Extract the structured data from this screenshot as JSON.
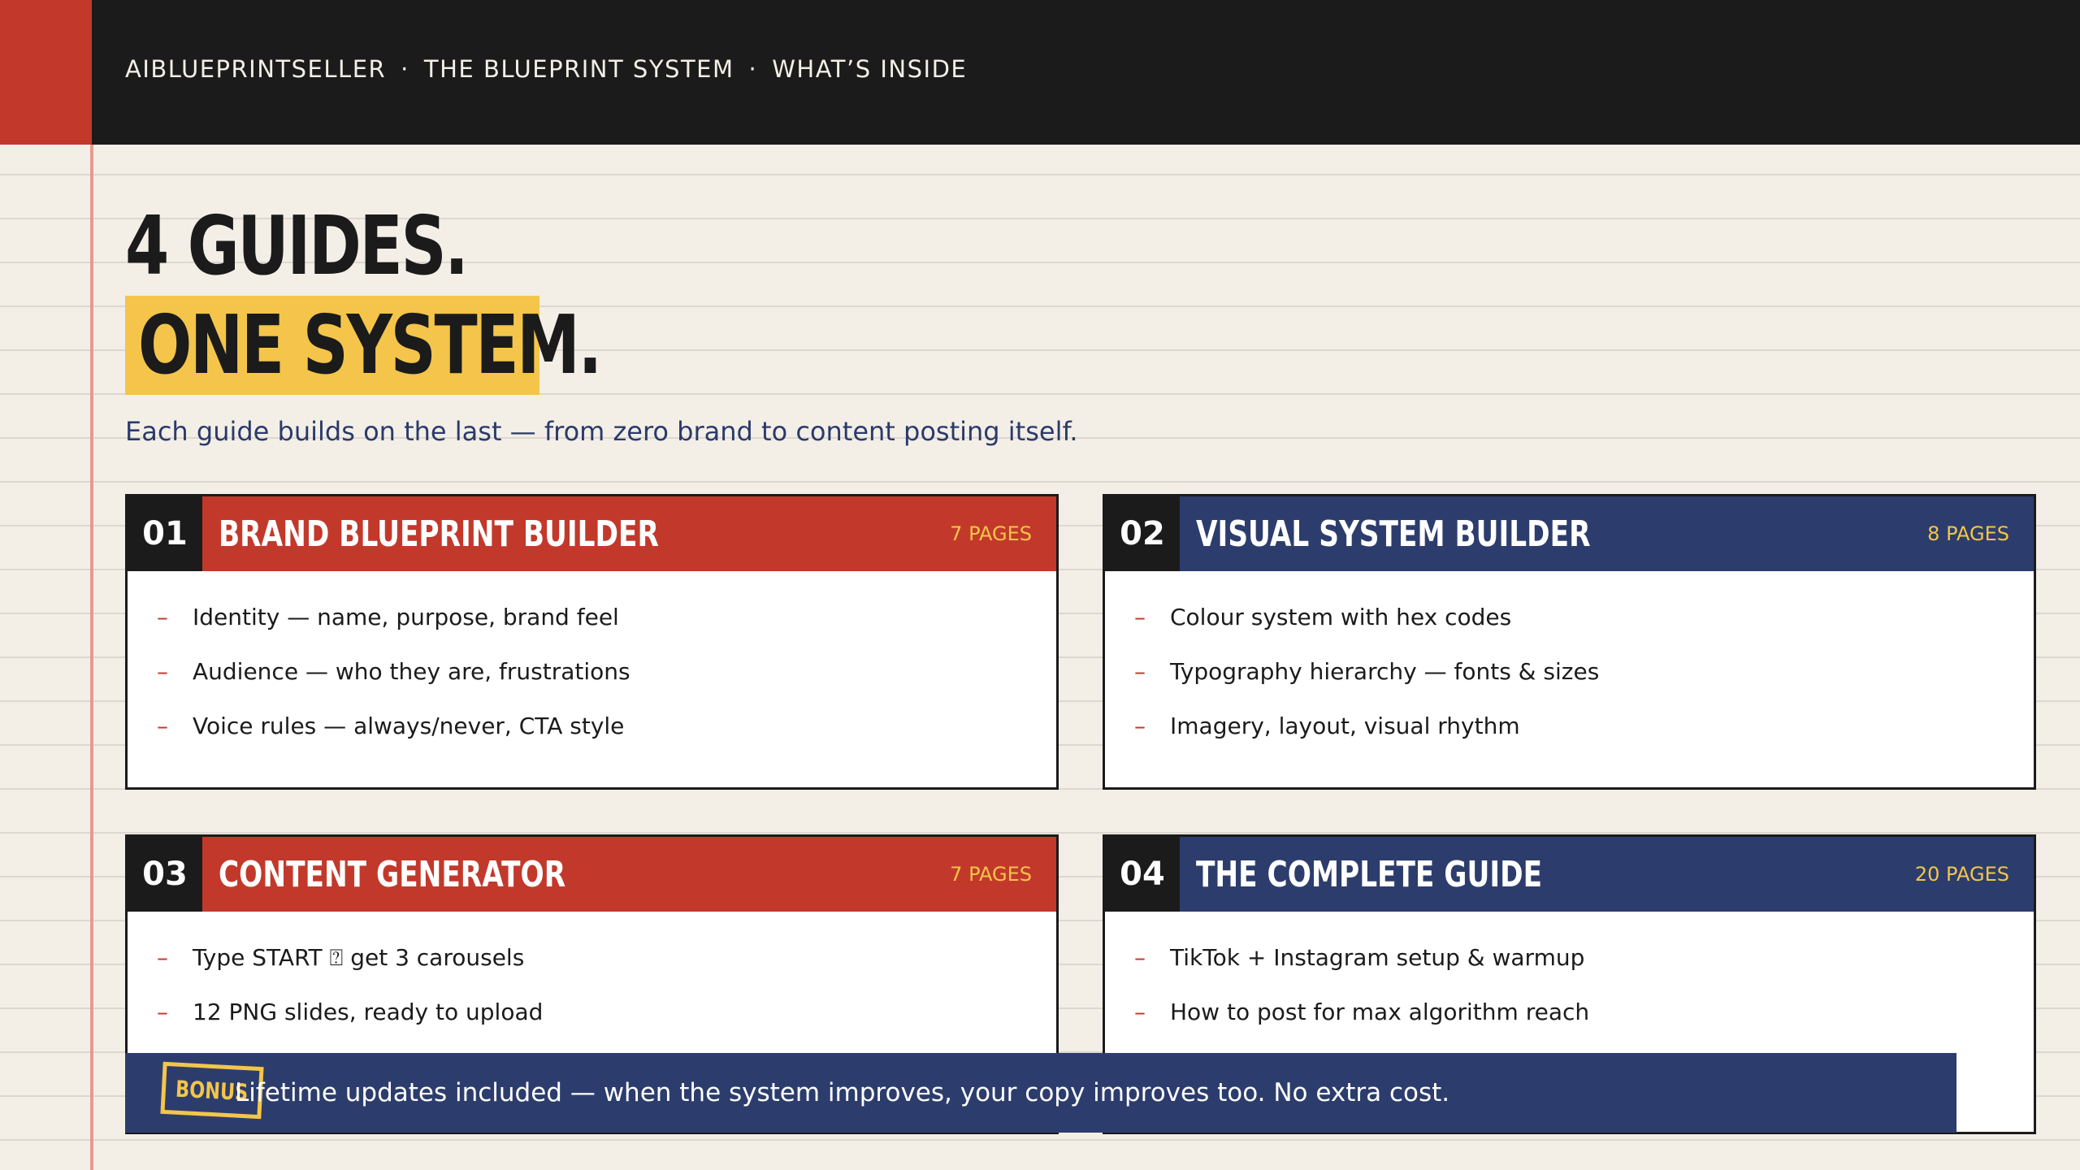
{
  "header": {
    "breadcrumb": [
      "AIBLUEPRINTSELLER",
      "THE BLUEPRINT SYSTEM",
      "WHAT’S INSIDE"
    ],
    "separator": "·"
  },
  "hero": {
    "headline_line1": "4 GUIDES.",
    "headline_line2": "ONE SYSTEM.",
    "subtitle": "Each guide builds on the last — from zero brand to content posting itself."
  },
  "guides": [
    {
      "number": "01",
      "title": "BRAND BLUEPRINT BUILDER",
      "pages": "7 PAGES",
      "items": [
        "Identity — name, purpose, brand feel",
        "Audience — who they are, frustrations",
        "Voice rules — always/never, CTA style"
      ]
    },
    {
      "number": "02",
      "title": "VISUAL SYSTEM BUILDER",
      "pages": "8 PAGES",
      "items": [
        "Colour system with hex codes",
        "Typography hierarchy — fonts & sizes",
        "Imagery, layout, visual rhythm"
      ]
    },
    {
      "number": "03",
      "title": "CONTENT GENERATOR",
      "pages": "7 PAGES",
      "items": [
        "Type START ⍰ get 3 carousels",
        "12 PNG slides, ready to upload"
      ]
    },
    {
      "number": "04",
      "title": "THE COMPLETE GUIDE",
      "pages": "20 PAGES",
      "items": [
        "TikTok + Instagram setup & warmup",
        "How to post for max algorithm reach"
      ]
    }
  ],
  "bonus": {
    "badge": "BONUS",
    "text": "Lifetime updates included — when the system improves, your copy improves too. No extra cost."
  },
  "colors": {
    "background": "#f3efe7",
    "dark": "#1b1b1b",
    "red": "#c2392b",
    "navy": "#2c3d6d",
    "yellow": "#f4c54a"
  }
}
